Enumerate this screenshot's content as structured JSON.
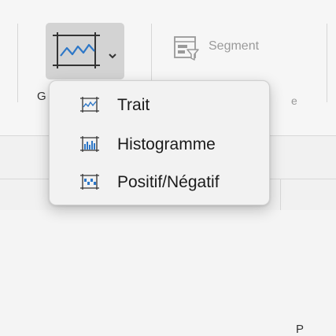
{
  "ribbon": {
    "sparkline_button": {
      "icon": "line-sparkline-icon",
      "dropdown_icon": "chevron-down-icon"
    },
    "segment": {
      "label": "Segment",
      "icon": "slicer-icon"
    },
    "partial_left_label": "G",
    "partial_right_label": "e"
  },
  "sheet": {
    "partial_column_label": "P"
  },
  "menu": {
    "items": [
      {
        "label": "Trait",
        "icon": "sparkline-line-icon"
      },
      {
        "label": "Histogramme",
        "icon": "sparkline-column-icon"
      },
      {
        "label": "Positif/Négatif",
        "icon": "sparkline-win-loss-icon"
      }
    ]
  },
  "colors": {
    "accent_blue": "#2d77c7",
    "button_pressed": "#d3d3d3"
  }
}
